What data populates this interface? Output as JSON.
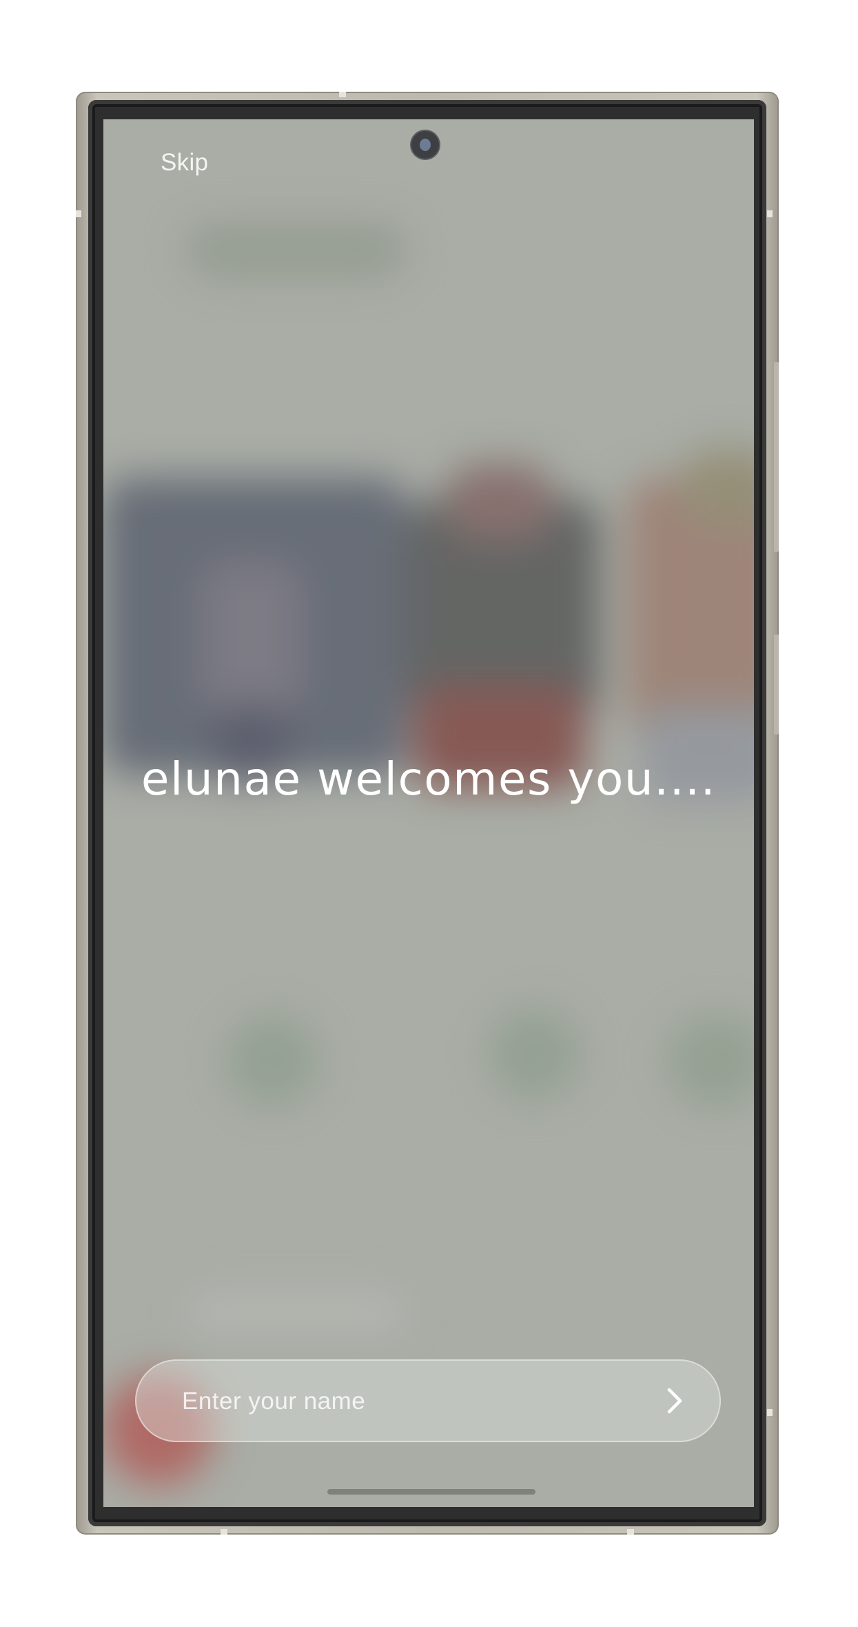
{
  "onboarding": {
    "skip_label": "Skip",
    "welcome_text": "elunae welcomes you....",
    "name_placeholder": "Enter your name",
    "name_value": ""
  },
  "icons": {
    "next": "chevron-right-icon",
    "camera": "front-camera-icon"
  },
  "colors": {
    "screen_background": "#a9ada6",
    "text": "#ffffff",
    "input_bar": "#dfe2de"
  }
}
